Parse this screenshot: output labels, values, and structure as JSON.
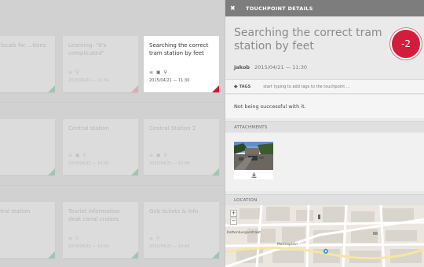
{
  "board": {
    "cards": [
      {
        "title": "...ing locals for ...tions",
        "date": "",
        "corner": "green"
      },
      {
        "title": "Learning: \"it's complicated\"",
        "date": "2015/04/21 — 11:34",
        "corner": "pink"
      },
      {
        "title": "Searching the correct tram station by feet",
        "date": "2015/04/21 — 11:30",
        "corner": "red"
      },
      {
        "title": "",
        "date": "",
        "corner": "green"
      },
      {
        "title": "Central station",
        "date": "2015/04/21 — 10:00",
        "corner": "green"
      },
      {
        "title": "Central Station 2",
        "date": "2015/04/21 — 12:08",
        "corner": "green"
      },
      {
        "title": "...central station",
        "date": "",
        "corner": "green"
      },
      {
        "title": "Tourist information desk canal cruises",
        "date": "2015/04/21 — 10:04",
        "corner": "green"
      },
      {
        "title": "Gvb tickets & info",
        "date": "2015/04/21 — 10:44",
        "corner": "green"
      }
    ]
  },
  "panel": {
    "header_title": "TOUCHPOINT DETAILS",
    "close_symbol": "✖",
    "title": "Searching the correct tram station by feet",
    "score": "-2",
    "author": "Jakob",
    "timestamp": "2015/04/21 — 11:30",
    "tags_label": "TAGS",
    "tags_placeholder": "start typing to add tags to the touchpoint ...",
    "description": "Not being successful with it.",
    "attachments_label": "ATTACHMENTS",
    "location_label": "LOCATION",
    "map": {
      "zoom_in": "+",
      "zoom_out": "−",
      "labels": [
        "Kattenburgerstraat",
        "Marnixplein"
      ]
    }
  },
  "colors": {
    "accent": "#d21e3c",
    "header": "#7d7d7d",
    "positive": "#6fb48f"
  }
}
